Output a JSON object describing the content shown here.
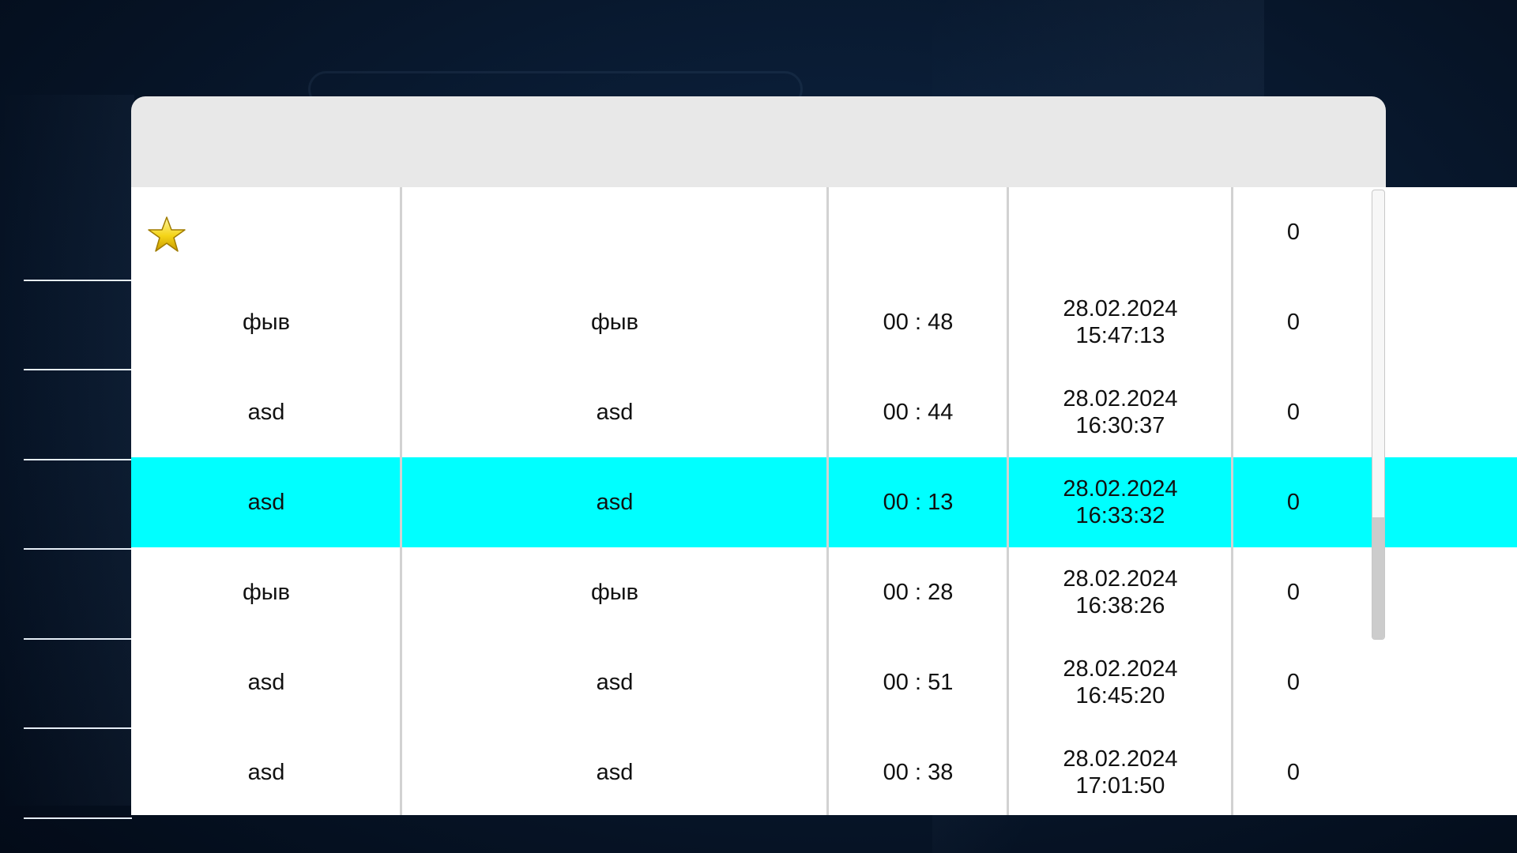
{
  "table": {
    "first_row": {
      "favorite_icon": "star-icon",
      "value": "0"
    },
    "rows": [
      {
        "col1": "фыв",
        "col2": "фыв",
        "time": "00 : 48",
        "date": "28.02.2024",
        "clock": "15:47:13",
        "value": "0"
      },
      {
        "col1": "asd",
        "col2": "asd",
        "time": "00 : 44",
        "date": "28.02.2024",
        "clock": "16:30:37",
        "value": "0"
      },
      {
        "col1": "asd",
        "col2": "asd",
        "time": "00 : 13",
        "date": "28.02.2024",
        "clock": "16:33:32",
        "value": "0",
        "selected": true
      },
      {
        "col1": "фыв",
        "col2": "фыв",
        "time": "00 : 28",
        "date": "28.02.2024",
        "clock": "16:38:26",
        "value": "0"
      },
      {
        "col1": "asd",
        "col2": "asd",
        "time": "00 : 51",
        "date": "28.02.2024",
        "clock": "16:45:20",
        "value": "0"
      },
      {
        "col1": "asd",
        "col2": "asd",
        "time": "00 : 38",
        "date": "28.02.2024",
        "clock": "17:01:50",
        "value": "0"
      }
    ]
  },
  "colors": {
    "selected_row": "#00ffff",
    "header": "#e8e8e8",
    "background": "#061325"
  }
}
